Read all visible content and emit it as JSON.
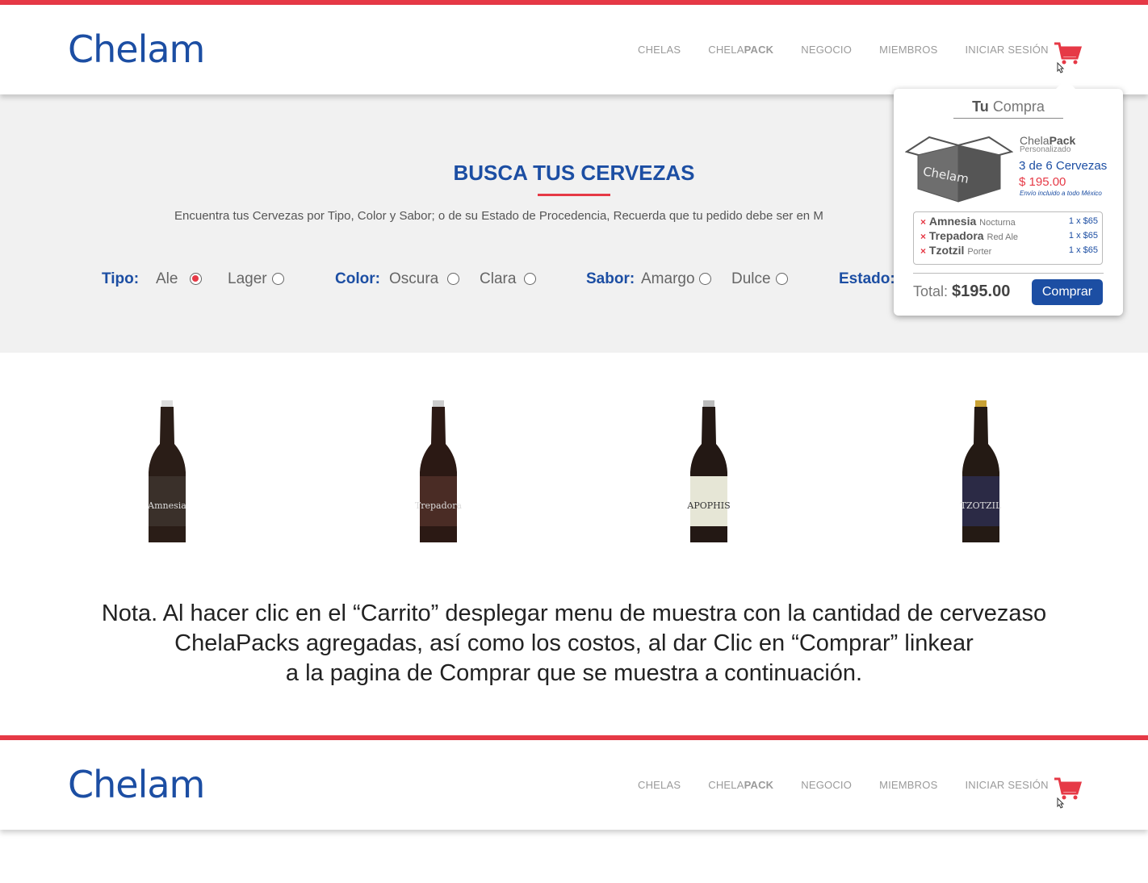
{
  "brand": {
    "logo_text": "Chelam",
    "primary_color": "#1c4ea3",
    "accent_color": "#e63946"
  },
  "nav": {
    "items": [
      {
        "label": "CHELAS"
      },
      {
        "prefix": "CHELA",
        "bold": "PACK"
      },
      {
        "label": "NEGOCIO"
      },
      {
        "label": "MIEMBROS"
      },
      {
        "label": "INICIAR SESIÓN"
      }
    ],
    "cart_icon": "cart-icon"
  },
  "search": {
    "title": "BUSCA TUS CERVEZAS",
    "subtitle": "Encuentra tus Cervezas por Tipo, Color y Sabor; o de su Estado de Procedencia, Recuerda que tu pedido debe ser en M",
    "filters": {
      "tipo_label": "Tipo:",
      "tipo_options": [
        "Ale",
        "Lager"
      ],
      "color_label": "Color:",
      "color_options": [
        "Oscura",
        "Clara"
      ],
      "sabor_label": "Sabor:",
      "sabor_options": [
        "Amargo",
        "Dulce"
      ],
      "estado_label": "Estado:"
    },
    "selected": "Ale"
  },
  "products": [
    {
      "label": "Amnesia"
    },
    {
      "label": "Trepadora"
    },
    {
      "label": "APOPHIS"
    },
    {
      "label": "TZOTZIL"
    }
  ],
  "note": {
    "line1": "Nota. Al hacer clic en el “Carrito” desplegar menu de muestra con la cantidad de cervezaso",
    "line2": "ChelaPacks agregadas, así como los costos, al dar Clic en “Comprar” linkear",
    "line3": "a la pagina de Comprar que se muestra a continuación."
  },
  "cart_popup": {
    "title_bold": "Tu",
    "title_rest": "Compra",
    "box_logo": "Chelam",
    "pack_prefix": "Chela",
    "pack_bold": "Pack",
    "pack_sub": "Personalizado",
    "pack_count": "3 de 6 Cervezas",
    "pack_price": "$ 195.00",
    "pack_ship": "Envío incluido a todo México",
    "remove_symbol": "×",
    "items": [
      {
        "name": "Amnesia",
        "variant": "Nocturna",
        "qty": "1 x $65"
      },
      {
        "name": "Trepadora",
        "variant": "Red Ale",
        "qty": "1 x $65"
      },
      {
        "name": "Tzotzil",
        "variant": "Porter",
        "qty": "1 x $65"
      }
    ],
    "total_label": "Total:",
    "total_value": "$195.00",
    "buy_label": "Comprar"
  }
}
